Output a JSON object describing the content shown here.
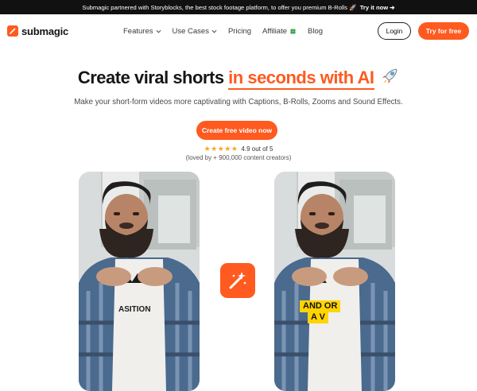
{
  "banner": {
    "text": "Submagic partnered with Storyblocks, the best stock footage platform, to offer you premium B-Rolls 🚀",
    "cta": "Try it now ➔"
  },
  "brand": {
    "name": "submagic",
    "accent": "#ff5a1f"
  },
  "nav": {
    "items": [
      {
        "label": "Features",
        "dropdown": true
      },
      {
        "label": "Use Cases",
        "dropdown": true
      },
      {
        "label": "Pricing"
      },
      {
        "label": "Affiliate"
      },
      {
        "label": "Blog"
      }
    ],
    "login": "Login",
    "try": "Try for free"
  },
  "hero": {
    "title_a": "Create viral shorts ",
    "title_b": "in seconds with AI",
    "subtitle": "Make your short-form videos more captivating with Captions, B-Rolls, Zooms and Sound Effects.",
    "cta": "Create free video now",
    "stars": "★★★★★",
    "rating": "4.9 out of 5",
    "loved": "(loved by + 900,000 content creators)"
  },
  "demo": {
    "shirt_text": "ASITION",
    "caption_line1": "AND OR",
    "caption_line2": "A V"
  },
  "icons": [
    "chevron-down-icon",
    "clover-icon",
    "rocket-icon",
    "magic-wand-icon"
  ]
}
